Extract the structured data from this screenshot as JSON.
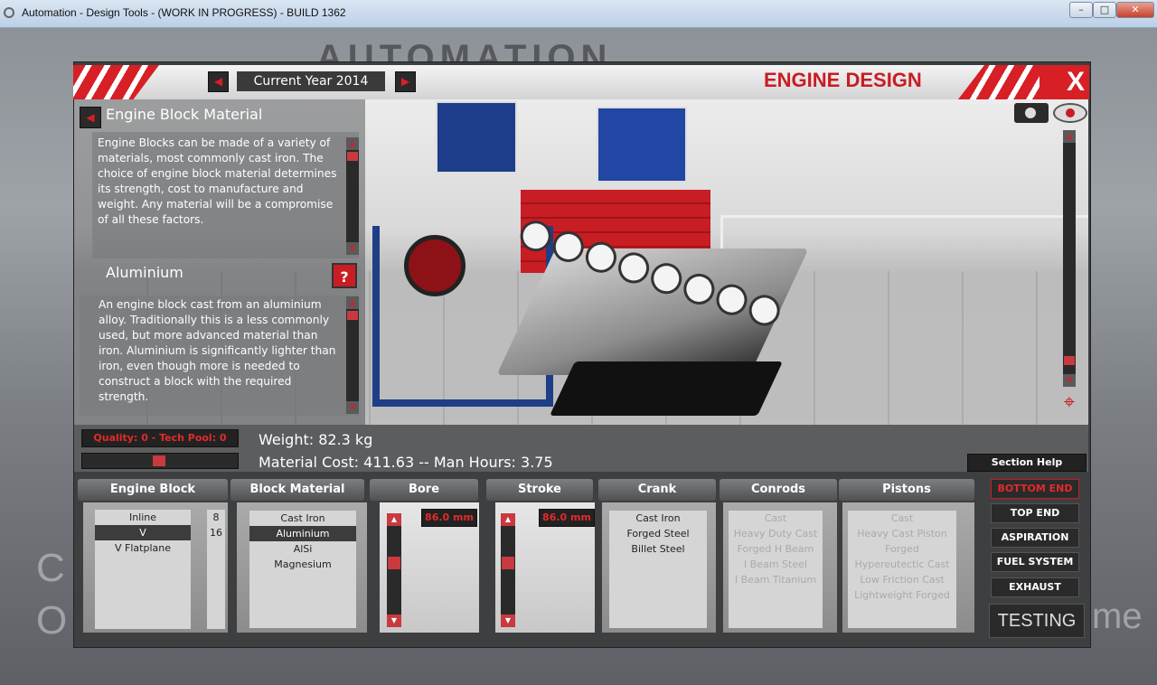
{
  "window": {
    "title": "Automation - Design Tools - (WORK IN PROGRESS) - BUILD 1362"
  },
  "header": {
    "year_label": "Current Year 2014",
    "screen_title": "ENGINE DESIGN",
    "close_label": "X"
  },
  "info": {
    "heading": "Engine Block Material",
    "description": "Engine Blocks can be made of a variety of materials, most commonly cast iron. The choice of engine block material determines its strength, cost to manufacture and weight. Any material will be a compromise of all these factors.",
    "material_title": "Aluminium",
    "help_label": "?",
    "material_description": "An engine block cast from an aluminium alloy. Traditionally this is a less commonly used, but more advanced material than iron. Aluminium is significantly lighter than iron, even though more is needed to construct a block with the required strength."
  },
  "stats": {
    "quality": "Quality: 0 - Tech Pool: 0",
    "weight": "Weight: 82.3 kg",
    "cost": "Material Cost: 411.63 -- Man Hours: 3.75",
    "section_help": "Section Help"
  },
  "columns": {
    "engine_block": {
      "header": "Engine Block",
      "items": [
        "Inline",
        "V",
        "V Flatplane"
      ],
      "counts": [
        "8",
        "16"
      ]
    },
    "block_material": {
      "header": "Block Material",
      "items": [
        "Cast Iron",
        "Aluminium",
        "AlSi",
        "Magnesium"
      ]
    },
    "bore": {
      "header": "Bore",
      "value": "86.0 mm",
      "level_fraction": 0.6
    },
    "stroke": {
      "header": "Stroke",
      "value": "86.0 mm",
      "level_fraction": 0.6
    },
    "crank": {
      "header": "Crank",
      "items": [
        "Cast Iron",
        "Forged Steel",
        "Billet Steel"
      ]
    },
    "conrods": {
      "header": "Conrods",
      "items": [
        "Cast",
        "Heavy Duty Cast",
        "Forged H Beam",
        "I Beam Steel",
        "I Beam Titanium"
      ]
    },
    "pistons": {
      "header": "Pistons",
      "items": [
        "Cast",
        "Heavy Cast Piston",
        "Forged",
        "Hypereutectic Cast",
        "Low Friction Cast",
        "Lightweight Forged"
      ]
    }
  },
  "sections": [
    "BOTTOM END",
    "TOP END",
    "ASPIRATION",
    "FUEL SYSTEM",
    "EXHAUST"
  ],
  "testing_label": "TESTING",
  "background_text": {
    "logo": "AUTOMATION",
    "left_line1": "C",
    "left_line2": "O",
    "right": "me"
  },
  "colors": {
    "accent": "#d71f26",
    "panel": "#3d3f41"
  }
}
